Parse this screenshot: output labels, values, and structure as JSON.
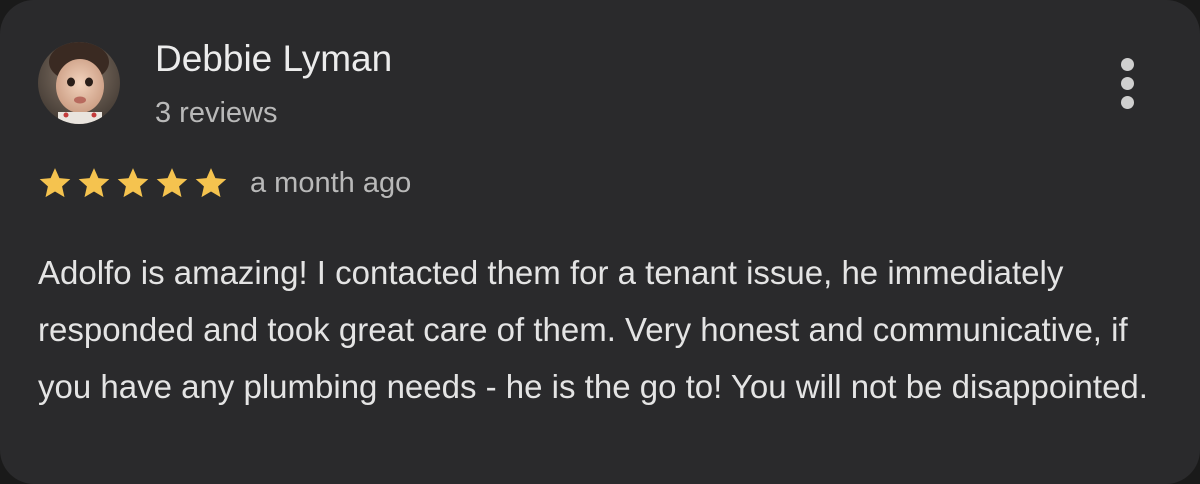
{
  "review": {
    "author_name": "Debbie Lyman",
    "author_reviews": "3 reviews",
    "rating": 5,
    "rating_max": 5,
    "date": "a month ago",
    "text": "Adolfo is amazing! I contacted them for a tenant issue, he immediately responded and took great care of them. Very honest and communicative, if you have any plumbing needs - he is the go to! You will not be disappointed."
  },
  "icons": {
    "more": "more-vertical-icon",
    "star": "star-icon",
    "avatar": "profile-photo"
  },
  "colors": {
    "card_background": "#2a2a2c",
    "star": "#f5c34f",
    "primary_text": "#ececec",
    "secondary_text": "#b9b9b9"
  }
}
